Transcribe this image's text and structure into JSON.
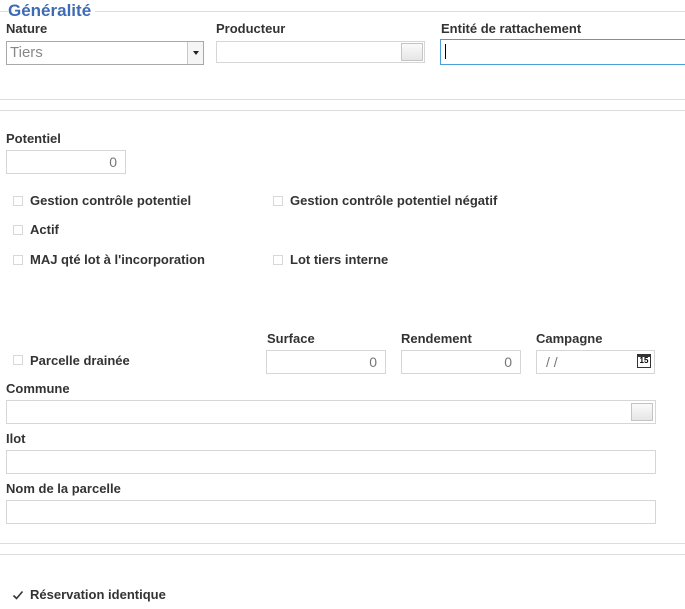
{
  "section": {
    "title": "Généralité"
  },
  "nature": {
    "label": "Nature",
    "value": "Tiers"
  },
  "producteur": {
    "label": "Producteur",
    "value": ""
  },
  "entite": {
    "label": "Entité de rattachement",
    "value": ""
  },
  "potentiel": {
    "label": "Potentiel",
    "value": "0"
  },
  "checkboxes": {
    "gestion_controle_potentiel": {
      "label": "Gestion contrôle potentiel",
      "checked": false
    },
    "gestion_controle_potentiel_negatif": {
      "label": "Gestion contrôle potentiel négatif",
      "checked": false
    },
    "actif": {
      "label": "Actif",
      "checked": false
    },
    "maj_qte_lot": {
      "label": "MAJ qté lot à l'incorporation",
      "checked": false
    },
    "lot_tiers_interne": {
      "label": "Lot tiers interne",
      "checked": false
    },
    "parcelle_drainee": {
      "label": "Parcelle drainée",
      "checked": false
    },
    "reservation_identique": {
      "label": "Réservation identique",
      "checked": true
    }
  },
  "surface": {
    "label": "Surface",
    "value": "0"
  },
  "rendement": {
    "label": "Rendement",
    "value": "0"
  },
  "campagne": {
    "label": "Campagne",
    "value": "/ /",
    "icon_text": "15"
  },
  "commune": {
    "label": "Commune",
    "value": ""
  },
  "ilot": {
    "label": "Ilot",
    "value": ""
  },
  "nom_parcelle": {
    "label": "Nom de la parcelle",
    "value": ""
  },
  "icons": {
    "dropdown": "chevron-down-icon",
    "lookup": "lookup-button",
    "calendar": "calendar-icon",
    "check": "check-icon"
  },
  "colors": {
    "section_title": "#3e6bb5",
    "focus_border": "#4a9fd6",
    "field_border": "#d6d6d6"
  }
}
